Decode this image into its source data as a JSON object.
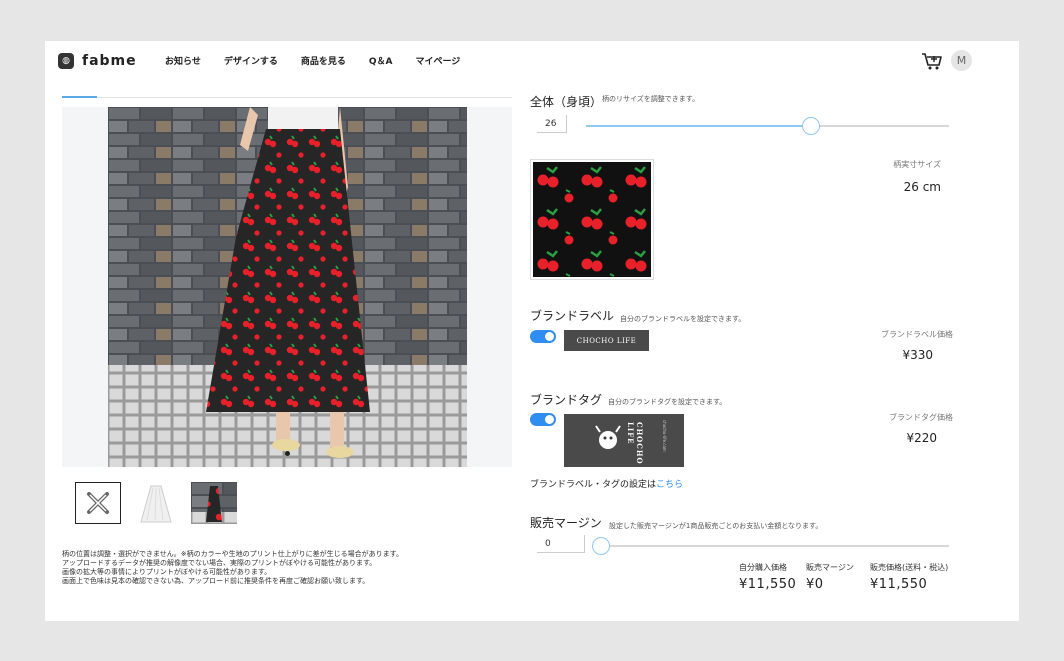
{
  "brand": {
    "name": "fabme"
  },
  "nav": {
    "items": [
      "お知らせ",
      "デザインする",
      "商品を見る",
      "Q＆A",
      "マイページ"
    ]
  },
  "user": {
    "avatar_initial": "M"
  },
  "notes": [
    "柄の位置は調整・選択ができません。※柄のカラーや生地のプリント仕上がりに差が生じる場合があります。",
    "アップロードするデータが推奨の解像度でない場合、実際のプリントがぼやける可能性があります。",
    "画像の拡大等の事情によりプリントがぼやける可能性があります。",
    "画面上で色味は見本の確認できない為、アップロード前に推奨条件を再度ご確認お願い致します。"
  ],
  "size_section": {
    "title": "全体（身頃）",
    "hint": "柄のリサイズを調整できます。",
    "value": "26",
    "slider_fraction": 0.62,
    "print_size_label": "柄実寸サイズ",
    "print_size_value": "26 cm"
  },
  "brand_label": {
    "title": "ブランドラベル",
    "hint": "自分のブランドラベルを設定できます。",
    "enabled": true,
    "image_text": "CHOCHO LIFE",
    "price_label": "ブランドラベル価格",
    "price_value": "¥330"
  },
  "brand_tag": {
    "title": "ブランドタグ",
    "hint": "自分のブランドタグを設定できます。",
    "enabled": true,
    "image_text_vertical": "CHOCHO LIFE",
    "image_small_text": "chocho-life.com",
    "price_label": "ブランドタグ価格",
    "price_value": "¥220",
    "settings_text": "ブランドラベル・タグの設定は",
    "settings_link": "こちら"
  },
  "margin_section": {
    "title": "販売マージン",
    "hint": "設定した販売マージンが1商品販売ごとのお支払い金額となります。",
    "value": "0",
    "slider_fraction": 0.0
  },
  "summary": {
    "self_purchase_label": "自分購入価格",
    "self_purchase_value": "¥11,550",
    "margin_label": "販売マージン",
    "margin_value": "¥0",
    "sale_price_label": "販売価格(送料・税込)",
    "sale_price_value": "¥11,550"
  },
  "colors": {
    "accent": "#2f8ef0",
    "slider": "#90c8ef",
    "pattern_bg": "#111111",
    "cherry": "#e8202a",
    "leaf": "#2aa043"
  }
}
